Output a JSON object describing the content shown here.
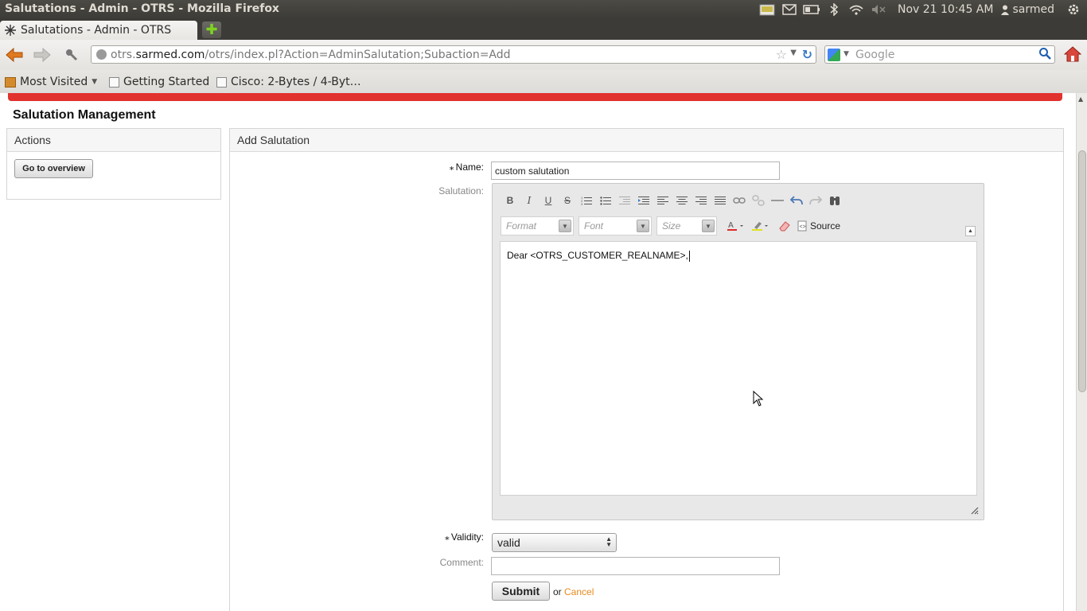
{
  "window": {
    "title": "Salutations - Admin - OTRS - Mozilla Firefox"
  },
  "tray": {
    "icons": [
      "weather-icon",
      "mail-icon",
      "battery-icon",
      "bluetooth-icon",
      "wifi-icon",
      "volume-muted-icon"
    ],
    "clock": "Nov 21 10:45 AM",
    "user": "sarmed",
    "settings_icon": "gear-icon"
  },
  "tabs": [
    {
      "label": "Salutations - Admin - OTRS",
      "icon": "otrs-favicon"
    }
  ],
  "nav": {
    "url_prefix": "otrs.",
    "url_domain": "sarmed.com",
    "url_path": "/otrs/index.pl?Action=AdminSalutation;Subaction=Add",
    "search_placeholder": "Google"
  },
  "bookmarks": [
    {
      "label": "Most Visited"
    },
    {
      "label": "Getting Started"
    },
    {
      "label": "Cisco: 2-Bytes / 4-Byt…"
    }
  ],
  "page": {
    "title": "Salutation Management",
    "sidebar": {
      "heading": "Actions",
      "overview_button": "Go to overview"
    },
    "form": {
      "heading": "Add Salutation",
      "name_label": "Name:",
      "name_value": "custom salutation",
      "salutation_label": "Salutation:",
      "editor": {
        "format_placeholder": "Format",
        "font_placeholder": "Font",
        "size_placeholder": "Size",
        "source_label": "Source",
        "content": "Dear <OTRS_CUSTOMER_REALNAME>,"
      },
      "validity_label": "Validity:",
      "validity_value": "valid",
      "comment_label": "Comment:",
      "comment_value": "",
      "submit_label": "Submit",
      "or_text": "or",
      "cancel_label": "Cancel"
    }
  },
  "colors": {
    "alert_bar": "#e1322e",
    "cancel_link": "#e68a1e"
  }
}
